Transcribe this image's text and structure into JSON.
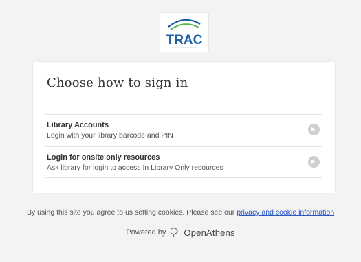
{
  "logo": {
    "text": "TRAC",
    "colors": {
      "blue": "#1f5fa8",
      "green": "#57b847"
    }
  },
  "card": {
    "title": "Choose how to sign in",
    "options": [
      {
        "title": "Library Accounts",
        "description": "Login with your library barcode and PIN",
        "icon": "chevron-right-circle-icon"
      },
      {
        "title": "Login for onsite only resources",
        "description": "Ask library for login to access In Library Only resources",
        "icon": "chevron-right-circle-icon"
      }
    ]
  },
  "footer": {
    "cookie_text": "By using this site you agree to us setting cookies. Please see our",
    "cookie_link": "privacy and cookie information",
    "powered_by": "Powered by",
    "brand": "OpenAthens"
  },
  "colors": {
    "background": "#f3f3f3",
    "link": "#2b57c4",
    "chevron": "#cfcfcf"
  }
}
